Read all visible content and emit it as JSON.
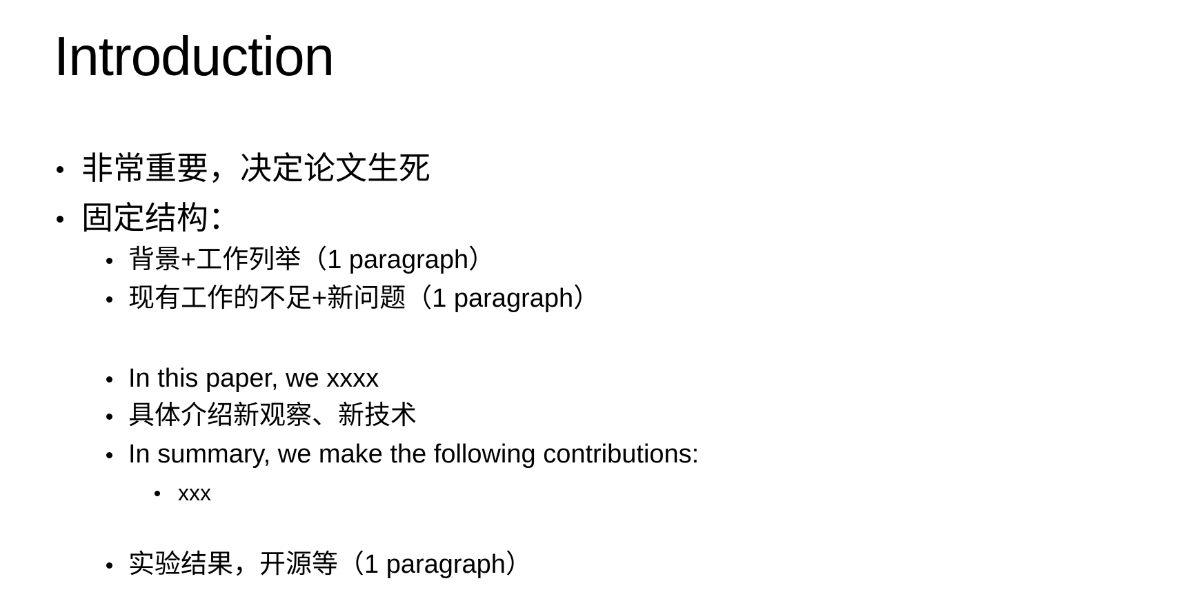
{
  "slide": {
    "title": "Introduction",
    "bullets": [
      {
        "level": 1,
        "text": "非常重要，决定论文生死"
      },
      {
        "level": 1,
        "text": "固定结构："
      },
      {
        "level": 2,
        "text": "背景+工作列举（1 paragraph）"
      },
      {
        "level": 2,
        "text": "现有工作的不足+新问题（1 paragraph）"
      },
      {
        "level": 2,
        "text": "In this paper, we xxxx"
      },
      {
        "level": 2,
        "text": "具体介绍新观察、新技术"
      },
      {
        "level": 2,
        "text": "In summary, we make the following contributions:"
      },
      {
        "level": 3,
        "text": "xxx"
      },
      {
        "level": 2,
        "text": "实验结果，开源等（1 paragraph）"
      }
    ]
  }
}
